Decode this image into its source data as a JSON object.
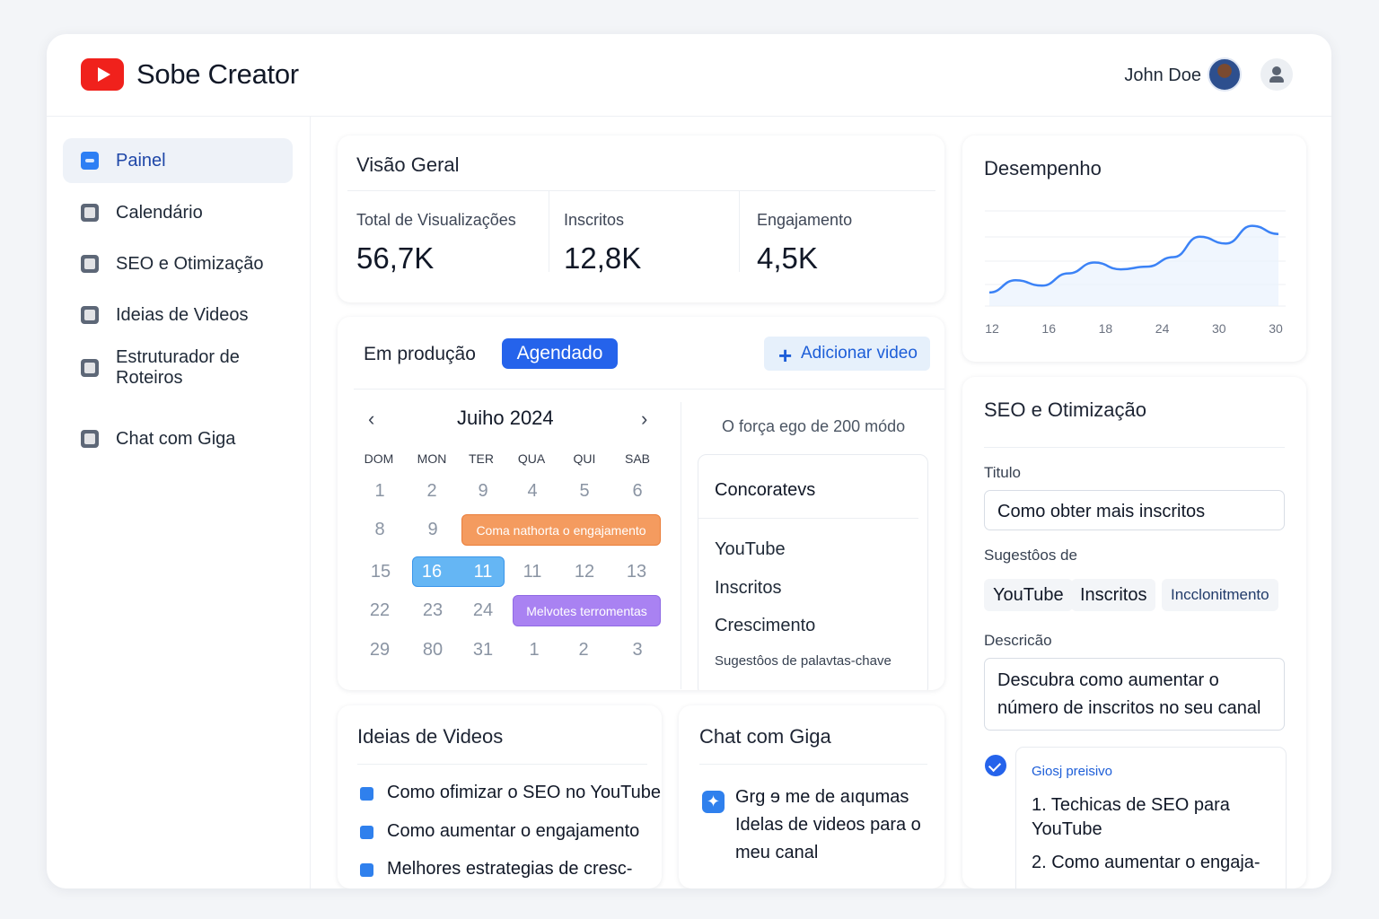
{
  "app": {
    "title": "Sobe Creator",
    "user_name": "John Doe"
  },
  "sidebar": {
    "items": [
      {
        "label": "Painel",
        "icon": "dashboard-icon",
        "active": true
      },
      {
        "label": "Calendário",
        "icon": "calendar-icon"
      },
      {
        "label": "SEO e Otimização",
        "icon": "seo-chart-icon"
      },
      {
        "label": "Ideias de Videos",
        "icon": "ideas-icon"
      },
      {
        "label": "Estruturador de Roteiros",
        "icon": "script-icon"
      },
      {
        "label": "Chat com Giga",
        "icon": "chat-icon"
      }
    ]
  },
  "overview": {
    "title": "Visão Geral",
    "stats": [
      {
        "label": "Total de Visualizações",
        "value": "56,7K"
      },
      {
        "label": "Inscritos",
        "value": "12,8K"
      },
      {
        "label": "Engajamento",
        "value": "4,5K"
      }
    ]
  },
  "production": {
    "title": "Em produção",
    "badge": "Agendado",
    "add_button": "Adicionar video",
    "calendar": {
      "month": "Juiho 2024",
      "prev": "‹",
      "next": "›",
      "weekdays": [
        "DOM",
        "MON",
        "TER",
        "QUA",
        "QUI",
        "SAB"
      ],
      "rows": [
        [
          "1",
          "2",
          "9",
          "4",
          "5",
          "6"
        ],
        [
          "8",
          "9",
          "",
          "",
          "",
          ""
        ],
        [
          "15",
          "16",
          "11",
          "11",
          "12",
          "13"
        ],
        [
          "22",
          "23",
          "24",
          "",
          "",
          ""
        ],
        [
          "29",
          "80",
          "31",
          "1",
          "2",
          "3"
        ]
      ],
      "events": [
        "Coma nathorta o engajamento",
        "Melvotes terromentas"
      ]
    },
    "note": "O força ego de 200 módo",
    "competitors": {
      "title": "Concoratevs",
      "items": [
        "YouTube",
        "Inscritos",
        "Crescimento"
      ],
      "footer": "Sugestôos de palavtas-chave"
    }
  },
  "performance": {
    "title": "Desempenho"
  },
  "chart_data": {
    "type": "line",
    "x": [
      "12",
      "16",
      "18",
      "24",
      "30",
      "30"
    ],
    "series": [
      {
        "values": [
          1.0,
          1.9,
          1.5,
          2.4,
          3.2,
          2.7,
          2.9,
          3.6,
          5.1,
          4.6,
          5.9,
          5.3
        ]
      }
    ],
    "ylim": [
      0,
      7
    ],
    "grid": true,
    "xlabel": "",
    "ylabel": "",
    "line_color": "#3b82f6"
  },
  "seo": {
    "title": "SEO e Otimização",
    "title_label": "Titulo",
    "title_value": "Como obter mais inscritos",
    "suggestions_label": "Sugestôos de",
    "tags": [
      "YouTube",
      "Inscritos",
      "Incclonitmento"
    ],
    "description_label": "Descricão",
    "description_value": "Descubra como aumentar o número de inscritos no seu canal",
    "suggestion_box": {
      "label": "Giosj preisivo",
      "items": [
        "1. Techicas de SEO para YouTube",
        "2. Como aumentar o engaja-"
      ]
    }
  },
  "ideas": {
    "title": "Ideias de Videos",
    "items": [
      "Como ofimizar o SEO no YouTube",
      "Como aumentar o engajamento",
      "Melhores estrategias de cresc-"
    ]
  },
  "chat": {
    "title": "Chat com Giga",
    "message": "Grg ɘ me de aıqumas Idelas de videos para o meu canal"
  }
}
